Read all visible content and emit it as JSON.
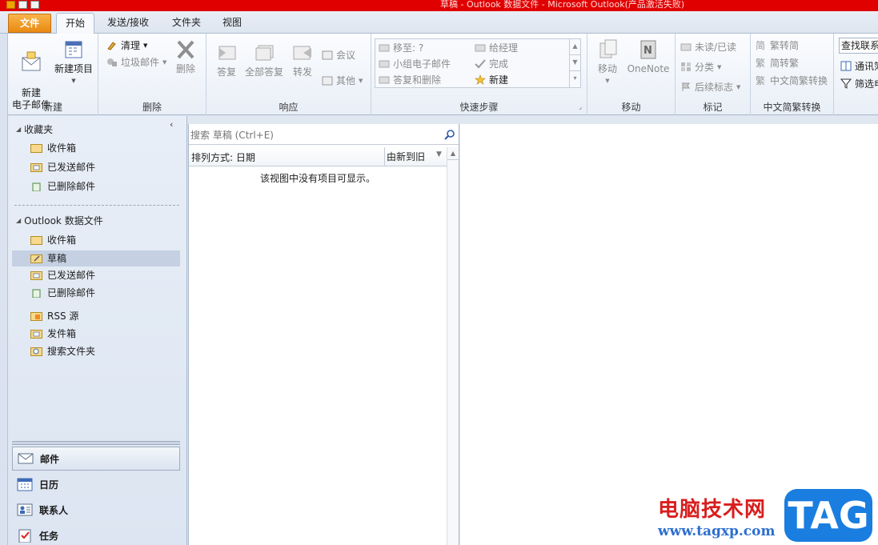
{
  "window": {
    "title": "草稿 - Outlook 数据文件 - Microsoft Outlook(产品激活失败)"
  },
  "tabs": {
    "file": "文件",
    "home": "开始",
    "send_receive": "发送/接收",
    "folder": "文件夹",
    "view": "视图"
  },
  "ribbon": {
    "new_group": {
      "label": "新建",
      "new_email": "新建\n电子邮件",
      "new_items": "新建项目"
    },
    "delete_group": {
      "label": "删除",
      "clean": "清理",
      "junk": "垃圾邮件",
      "delete": "删除"
    },
    "respond_group": {
      "label": "响应",
      "reply": "答复",
      "reply_all": "全部答复",
      "forward": "转发",
      "meeting": "会议",
      "more": "其他"
    },
    "quicksteps_group": {
      "label": "快速步骤",
      "move_to": "移至: ?",
      "to_manager": "给经理",
      "team_email": "小组电子邮件",
      "done": "完成",
      "reply_delete": "答复和删除",
      "create_new": "新建"
    },
    "move_group": {
      "label": "移动",
      "move": "移动",
      "onenote": "OneNote"
    },
    "tags_group": {
      "label": "标记",
      "unread_read": "未读/已读",
      "categorize": "分类",
      "follow_up": "后续标志"
    },
    "chinese_group": {
      "label": "中文简繁转换",
      "to_simplified": "繁转简",
      "to_traditional": "简转繁",
      "convert": "中文简繁转换"
    },
    "find_group": {
      "find_contact": "查找联系人",
      "address_book": "通讯簿",
      "filter": "筛选电"
    }
  },
  "nav": {
    "favorites": "收藏夹",
    "favorite_items": [
      "收件箱",
      "已发送邮件",
      "已删除邮件"
    ],
    "data_file": "Outlook 数据文件",
    "data_items": [
      "收件箱",
      "草稿",
      "已发送邮件",
      "已删除邮件"
    ],
    "extra_items": [
      "RSS 源",
      "发件箱",
      "搜索文件夹"
    ],
    "modules": [
      "邮件",
      "日历",
      "联系人",
      "任务"
    ]
  },
  "list": {
    "search_placeholder": "搜索 草稿 (Ctrl+E)",
    "arrange_by": "排列方式: 日期",
    "sort_order": "由新到旧",
    "empty_message": "该视图中没有项目可显示。"
  },
  "watermark": {
    "site_name": "电脑技术网",
    "url": "www.tagxp.com",
    "tag": "TAG"
  }
}
